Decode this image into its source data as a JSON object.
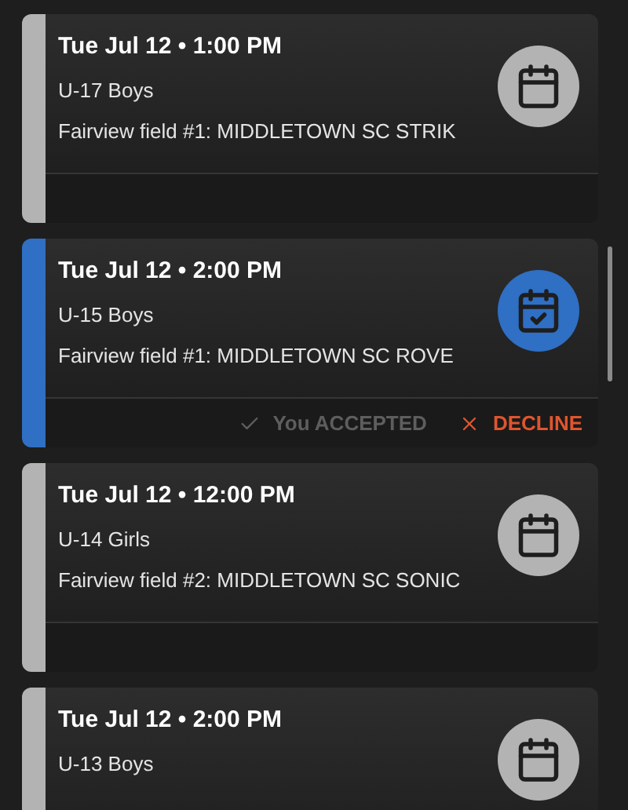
{
  "events": [
    {
      "title": "Tue Jul 12 • 1:00 PM",
      "team": "U-17 Boys",
      "location": "Fairview field #1: MIDDLETOWN SC STRIK",
      "accepted": false
    },
    {
      "title": "Tue Jul 12 • 2:00 PM",
      "team": "U-15 Boys",
      "location": "Fairview field #1: MIDDLETOWN SC ROVE",
      "accepted": true,
      "status_text": "You ACCEPTED",
      "decline_label": "DECLINE"
    },
    {
      "title": "Tue Jul 12 • 12:00 PM",
      "team": "U-14 Girls",
      "location": "Fairview field #2: MIDDLETOWN SC SONIC",
      "accepted": false
    },
    {
      "title": "Tue Jul 12 • 2:00 PM",
      "team": "U-13 Boys",
      "accepted": false
    }
  ]
}
